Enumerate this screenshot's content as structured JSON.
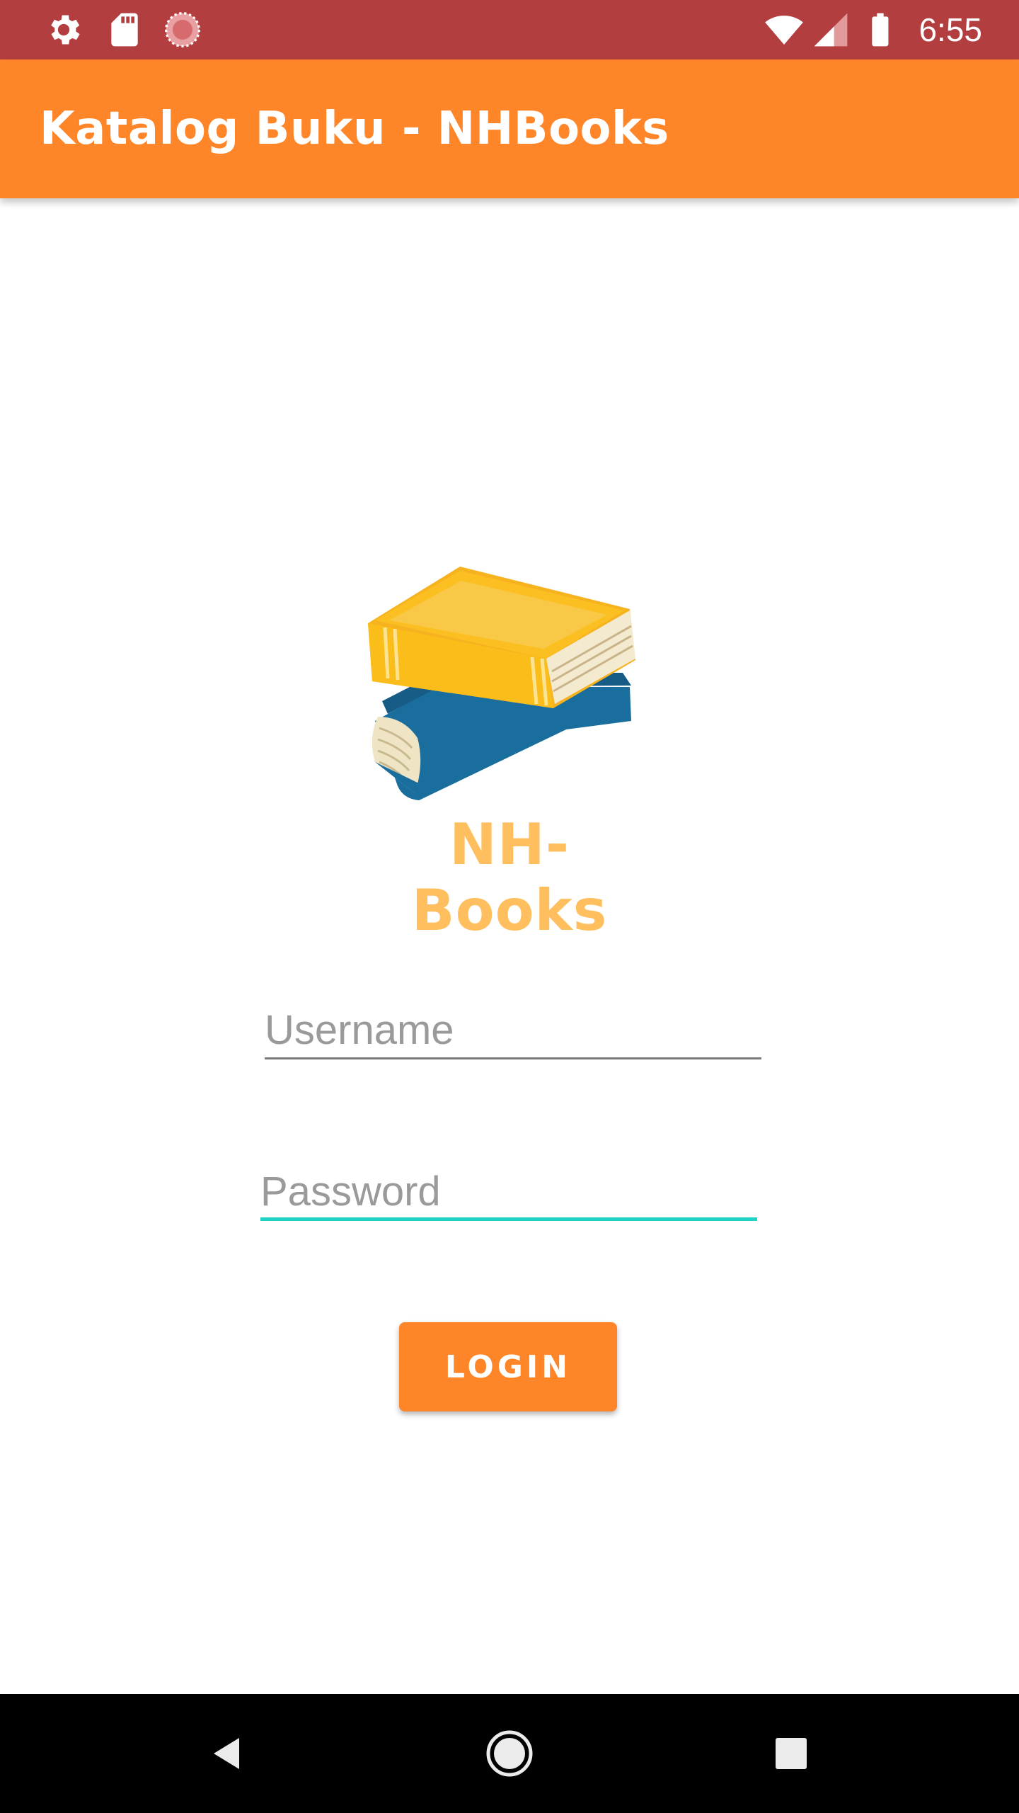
{
  "status_bar": {
    "time": "6:55",
    "icons": [
      "settings-icon",
      "sd-card-icon",
      "sync-circle-icon",
      "wifi-icon",
      "signal-icon",
      "battery-icon"
    ]
  },
  "app_bar": {
    "title": "Katalog Buku - NHBooks"
  },
  "logo": {
    "brand_text": "NH-Books"
  },
  "form": {
    "username_placeholder": "Username",
    "username_value": "",
    "password_placeholder": "Password",
    "password_value": "",
    "login_label": "LOGIN"
  },
  "nav_bar": {
    "buttons": [
      "back-icon",
      "home-icon",
      "recents-icon"
    ]
  },
  "colors": {
    "status_bar": "#b33e40",
    "app_bar": "#ff8529",
    "accent": "#1ed3c5",
    "brand_text": "#ffbf5e"
  }
}
